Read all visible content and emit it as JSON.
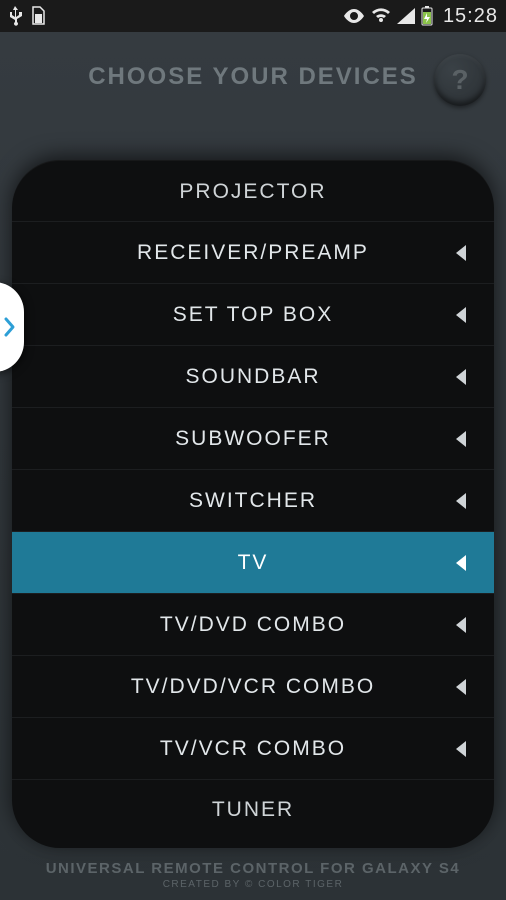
{
  "status": {
    "time": "15:28"
  },
  "header": {
    "title": "CHOOSE YOUR DEVICES",
    "help": "?"
  },
  "devices": [
    {
      "label": "PROJECTOR",
      "selected": false,
      "cut": "top"
    },
    {
      "label": "RECEIVER/PREAMP",
      "selected": false
    },
    {
      "label": "SET TOP BOX",
      "selected": false
    },
    {
      "label": "SOUNDBAR",
      "selected": false
    },
    {
      "label": "SUBWOOFER",
      "selected": false
    },
    {
      "label": "SWITCHER",
      "selected": false
    },
    {
      "label": "TV",
      "selected": true
    },
    {
      "label": "TV/DVD COMBO",
      "selected": false
    },
    {
      "label": "TV/DVD/VCR COMBO",
      "selected": false
    },
    {
      "label": "TV/VCR COMBO",
      "selected": false
    },
    {
      "label": "TUNER",
      "selected": false,
      "cut": "bottom"
    }
  ],
  "footer": {
    "line1": "UNIVERSAL REMOTE CONTROL FOR GALAXY S4",
    "line2": "CREATED BY © COLOR TIGER"
  },
  "colors": {
    "accent": "#1f7a97",
    "sheet_bg": "#0e0f10",
    "app_bg": "#2c3236"
  }
}
